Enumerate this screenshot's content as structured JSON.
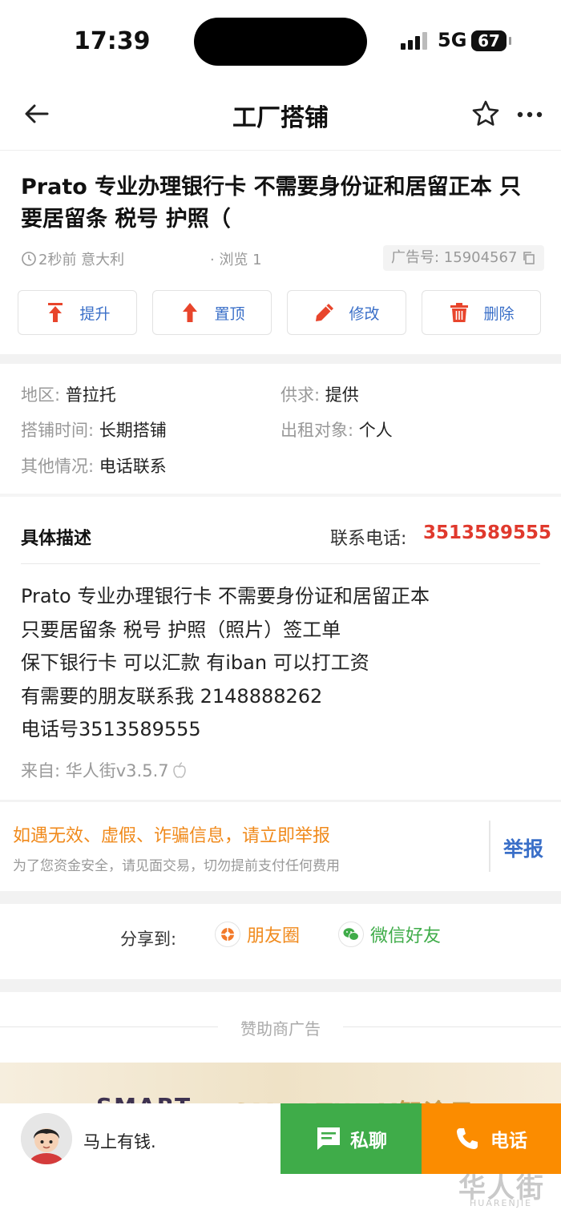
{
  "status_bar": {
    "time": "17:39",
    "network": "5G",
    "battery": "67"
  },
  "header": {
    "title": "工厂搭铺"
  },
  "post": {
    "title": "Prato 专业办理银行卡    不需要身份证和居留正本 只要居留条 税号 护照（",
    "posted": "2秒前 意大利",
    "views": "· 浏览 1",
    "ad_number": "广告号: 15904567"
  },
  "actions": [
    {
      "label": "提升",
      "icon": "boost-up-icon"
    },
    {
      "label": "置顶",
      "icon": "pin-top-icon"
    },
    {
      "label": "修改",
      "icon": "pencil-icon"
    },
    {
      "label": "删除",
      "icon": "trash-icon"
    }
  ],
  "info": {
    "region_label": "地区: ",
    "region": "普拉托",
    "supply_label": "供求: ",
    "supply": "提供",
    "duration_label": "搭铺时间: ",
    "duration": "长期搭铺",
    "target_label": "出租对象: ",
    "target": "个人",
    "other_label": "其他情况: ",
    "other": "电话联系"
  },
  "description": {
    "heading": "具体描述",
    "phone_label": "联系电话:",
    "phone": "3513589555",
    "body": "Prato 专业办理银行卡    不需要身份证和居留正本\n只要居留条 税号 护照（照片）签工单\n保下银行卡 可以汇款 有iban 可以打工资\n有需要的朋友联系我 2148888262\n电话号3513589555",
    "source": "来自: 华人街v3.5.7"
  },
  "report": {
    "warning": "如遇无效、虚假、诈骗信息，请立即举报",
    "notice": "为了您资金安全，请见面交易，切勿提前支付任何费用",
    "button": "举报"
  },
  "share": {
    "label": "分享到:",
    "moments": "朋友圈",
    "wechat": "微信好友"
  },
  "sponsor": {
    "label": "赞助商广告",
    "banner_left": "SMART",
    "banner_right": "SMARTWAY智途云"
  },
  "bottom_bar": {
    "username": "马上有钱.",
    "chat": "私聊",
    "call": "电话"
  },
  "watermark": {
    "text": "华人街",
    "sub": "HUARENJIE"
  },
  "colors": {
    "accent_blue": "#3a6fc8",
    "phone_red": "#e0392d",
    "warning_orange": "#f08a1c",
    "chat_green": "#3fac49",
    "call_orange": "#fb8c00",
    "icon_red": "#e8452c"
  }
}
